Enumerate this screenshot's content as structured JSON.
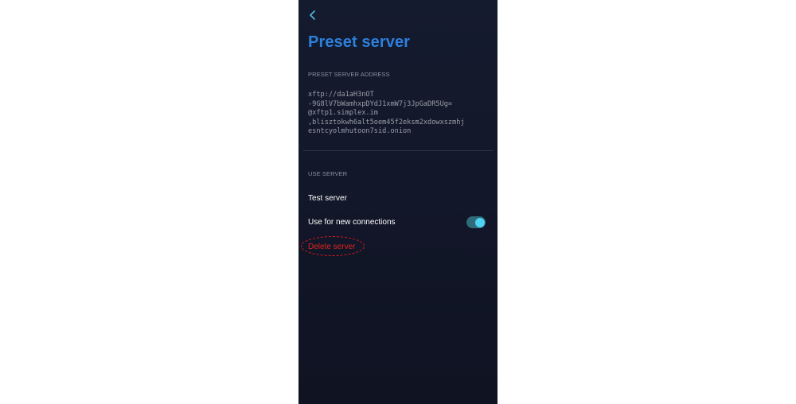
{
  "screen": {
    "title": "Preset server",
    "back_icon": "chevron-left-icon"
  },
  "preset_section": {
    "header": "PRESET SERVER ADDRESS",
    "address": "xftp://da1aH3nOT\n-9G8lV7bWamhxpDYdJ1xmW7j3JpGaDR5Ug=\n@xftp1.simplex.im\n,blisztokwh6alt5oem45f2eksm2xdowxszmhj\nesntcyolmhutoon7sid.onion"
  },
  "use_section": {
    "header": "USE SERVER",
    "test_label": "Test server",
    "new_connections_label": "Use for new connections",
    "new_connections_enabled": true,
    "delete_label": "Delete server"
  },
  "colors": {
    "title": "#2d7fdc",
    "toggle_on": "#4fd3f2",
    "delete": "#e0241e",
    "annotation_oval": "#e01818"
  }
}
